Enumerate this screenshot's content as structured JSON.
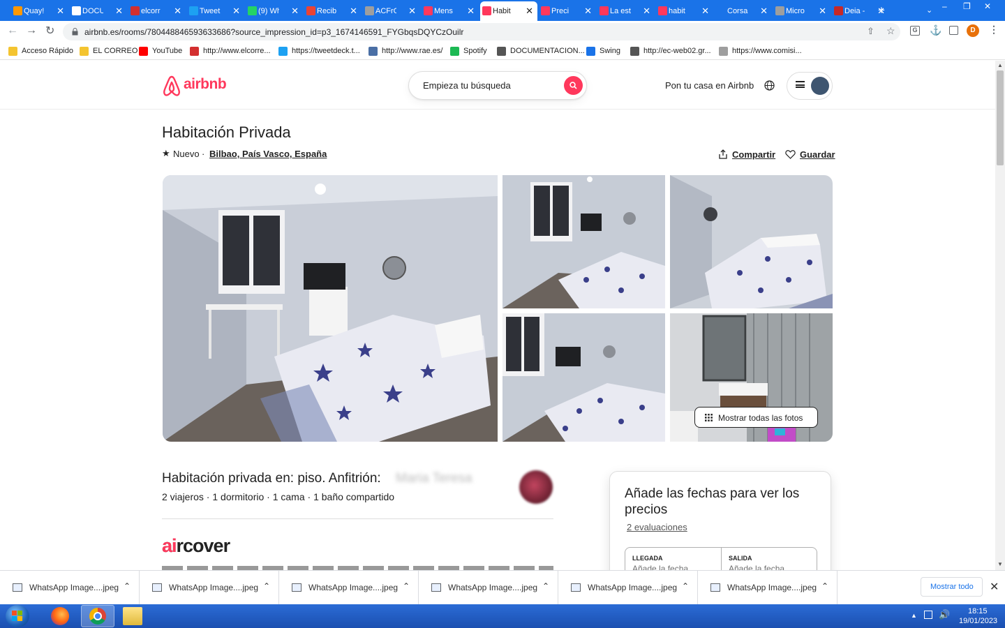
{
  "browser": {
    "tabs": [
      {
        "label": "Quay!",
        "color": "#ff9800"
      },
      {
        "label": "DOCU",
        "color": "#ffffff"
      },
      {
        "label": "elcorr",
        "color": "#d32f2f"
      },
      {
        "label": "Tweet",
        "color": "#1da1f2"
      },
      {
        "label": "(9) Wh",
        "color": "#25d366"
      },
      {
        "label": "Recib",
        "color": "#ea4335"
      },
      {
        "label": "ACFrC",
        "color": "#9e9e9e"
      },
      {
        "label": "Mens",
        "color": "#ff385c"
      },
      {
        "label": "Habit",
        "color": "#ff385c",
        "active": true
      },
      {
        "label": "Preci",
        "color": "#ff385c"
      },
      {
        "label": "La est",
        "color": "#ff385c"
      },
      {
        "label": "habit",
        "color": "#ff385c"
      },
      {
        "label": "Corsa",
        "color": "#1a73e8"
      },
      {
        "label": "Micro",
        "color": "#9e9e9e"
      },
      {
        "label": "Deia -",
        "color": "#c62828"
      }
    ],
    "url": "airbnb.es/rooms/780448846593633686?source_impression_id=p3_1674146591_FYGbqsDQYCzOuilr",
    "profile_initial": "D",
    "bookmarks": [
      {
        "label": "Acceso Rápido",
        "color": "#f4c430"
      },
      {
        "label": "EL CORREO",
        "color": "#f4c430"
      },
      {
        "label": "YouTube",
        "color": "#ff0000"
      },
      {
        "label": "http://www.elcorre...",
        "color": "#d32f2f"
      },
      {
        "label": "https://tweetdeck.t...",
        "color": "#1da1f2"
      },
      {
        "label": "http://www.rae.es/",
        "color": "#4a6fa5"
      },
      {
        "label": "Spotify",
        "color": "#1db954"
      },
      {
        "label": "DOCUMENTACION...",
        "color": "#555555"
      },
      {
        "label": "Swing",
        "color": "#1a73e8"
      },
      {
        "label": "http://ec-web02.gr...",
        "color": "#555555"
      },
      {
        "label": "https://www.comisi...",
        "color": "#9e9e9e"
      }
    ]
  },
  "airbnb": {
    "logo": "airbnb",
    "search_placeholder": "Empieza tu búsqueda",
    "host_link": "Pon tu casa en Airbnb",
    "brand_color": "#ff385c",
    "title": "Habitación Privada",
    "badge": "Nuevo",
    "location": "Bilbao, País Vasco, España",
    "share": "Compartir",
    "save": "Guardar",
    "show_all_photos": "Mostrar todas las fotos",
    "host_heading": "Habitación privada en: piso. Anfitrión:",
    "host_name": "Maria Teresa",
    "details": "2 viajeros · 1 dormitorio · 1 cama · 1 baño compartido",
    "aircover_logo": "aircover",
    "booking": {
      "heading": "Añade las fechas para ver los precios",
      "reviews": "2 evaluaciones",
      "checkin_label": "LLEGADA",
      "checkin_placeholder": "Añade la fecha",
      "checkout_label": "SALIDA",
      "checkout_placeholder": "Añade la fecha"
    }
  },
  "downloads": {
    "items": [
      "WhatsApp Image....jpeg",
      "WhatsApp Image....jpeg",
      "WhatsApp Image....jpeg",
      "WhatsApp Image....jpeg",
      "WhatsApp Image....jpeg",
      "WhatsApp Image....jpeg"
    ],
    "show_all": "Mostrar todo"
  },
  "taskbar": {
    "time": "18:15",
    "date": "19/01/2023"
  }
}
